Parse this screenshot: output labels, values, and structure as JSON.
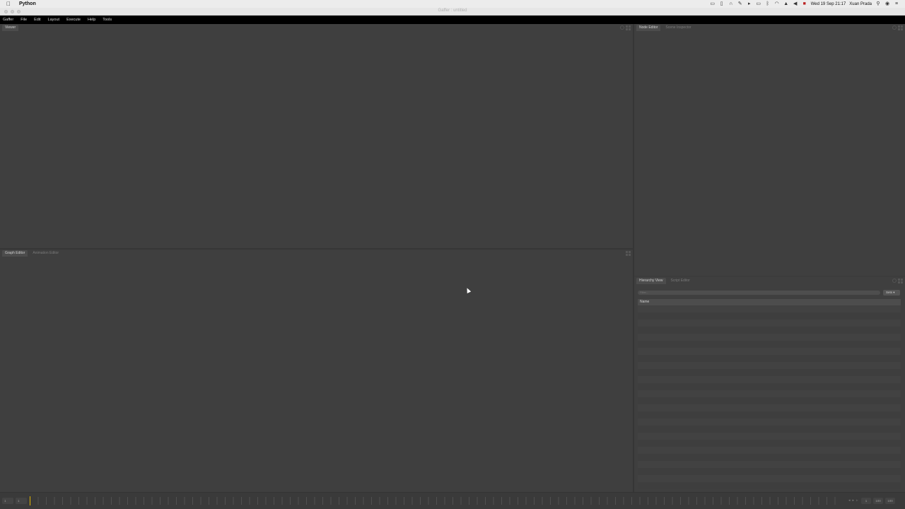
{
  "mac_menubar": {
    "apple": "",
    "app_name": "Python",
    "datetime": "Wed 19 Sep  21:17",
    "user": "Xuan Prada",
    "status_icons": [
      "display-icon",
      "battery-icon",
      "headphones-icon",
      "pen-icon",
      "volume-bar-icon",
      "airplay-icon",
      "bluetooth-icon",
      "wifi-icon",
      "eject-icon",
      "volume-icon",
      "flag-icon",
      "search-icon",
      "siri-icon",
      "list-icon"
    ]
  },
  "window": {
    "title": "Gaffer : untitled"
  },
  "app_menu": {
    "items": [
      "Gaffer",
      "File",
      "Edit",
      "Layout",
      "Execute",
      "Help",
      "Tools"
    ]
  },
  "viewer_panel": {
    "tabs": [
      "Viewer"
    ]
  },
  "graph_panel": {
    "tabs": [
      "Graph Editor",
      "Animation Editor"
    ]
  },
  "node_panel": {
    "tabs": [
      "Node Editor",
      "Scene Inspector"
    ]
  },
  "hierarchy_panel": {
    "tabs": [
      "Hierarchy View",
      "Script Editor"
    ],
    "filter_placeholder": "Filter...",
    "sets_button": "Sets",
    "column_header": "Name",
    "row_count": 26
  },
  "timeline": {
    "start_frame": "1",
    "current_frame": "1",
    "range_start": "1",
    "range_end": "100",
    "end_frame": "100",
    "playhead_fraction": 0.0
  }
}
